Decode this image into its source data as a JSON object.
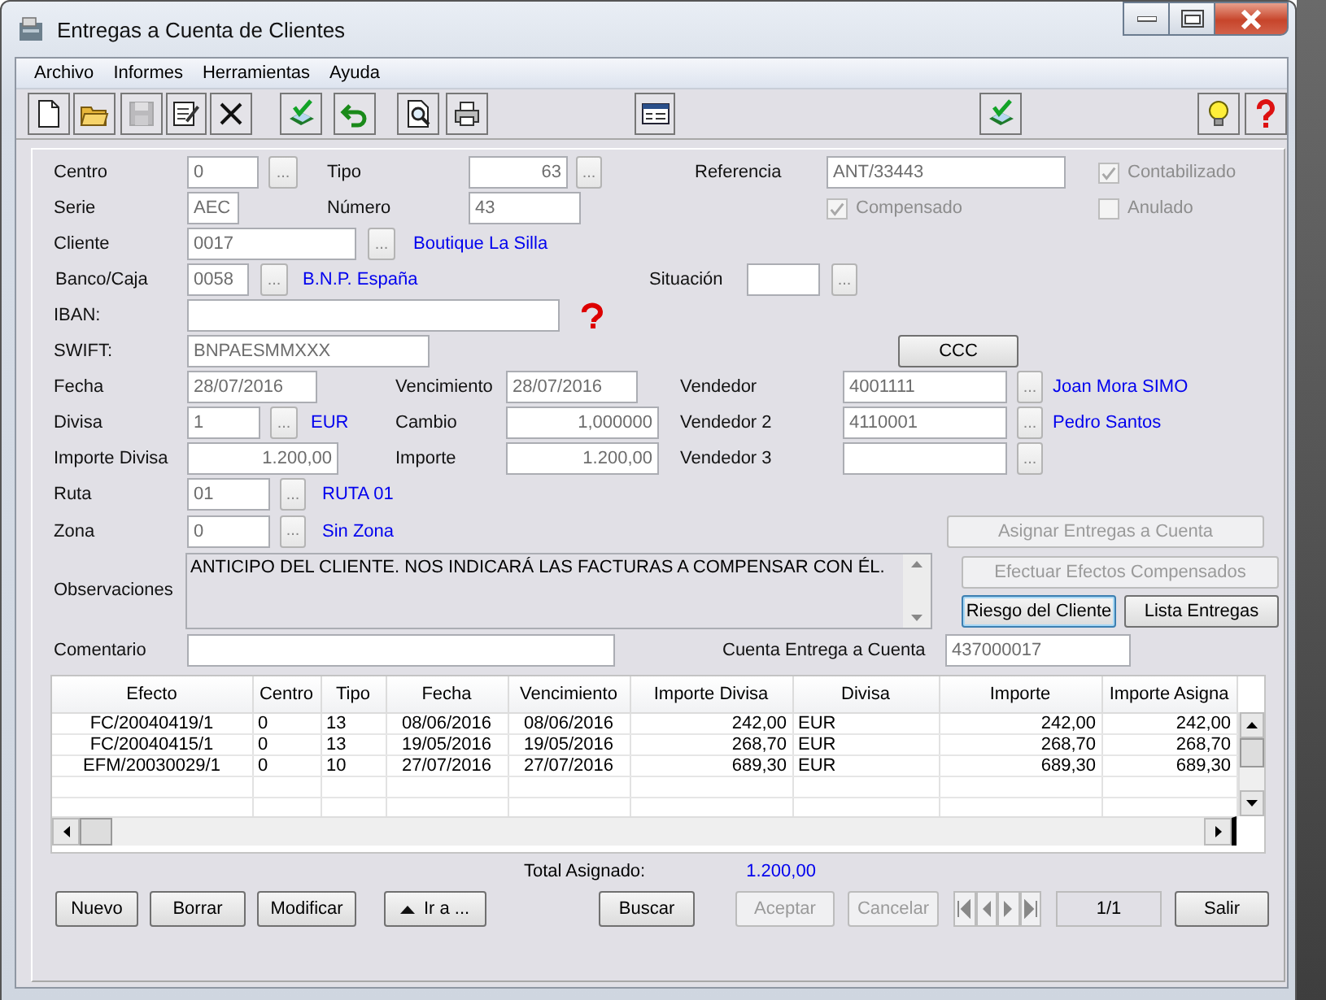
{
  "window": {
    "title": "Entregas a Cuenta de Clientes"
  },
  "menu": [
    "Archivo",
    "Informes",
    "Herramientas",
    "Ayuda"
  ],
  "toolbar": [
    {
      "kind": "new",
      "disabled": false
    },
    {
      "kind": "open",
      "disabled": false
    },
    {
      "kind": "save",
      "disabled": true
    },
    {
      "kind": "edit",
      "disabled": false
    },
    {
      "kind": "delete",
      "disabled": false
    },
    {
      "kind": "stamp",
      "disabled": false
    },
    {
      "kind": "undo",
      "disabled": false
    },
    {
      "kind": "preview",
      "disabled": false
    },
    {
      "kind": "print",
      "disabled": false
    },
    {
      "kind": "form",
      "disabled": false
    },
    {
      "kind": "stamp",
      "disabled": false
    },
    {
      "kind": "tip",
      "disabled": false
    },
    {
      "kind": "help",
      "disabled": false
    }
  ],
  "form": [
    [
      {
        "kind": "label",
        "text": "Centro"
      },
      {
        "kind": "field",
        "value": "0"
      },
      {
        "kind": "lookup",
        "text": "..."
      },
      {
        "kind": "label",
        "text": "Tipo"
      },
      {
        "kind": "field",
        "value": "63"
      },
      {
        "kind": "lookup",
        "text": "..."
      },
      {
        "kind": "label",
        "text": "Referencia"
      },
      {
        "kind": "field",
        "value": "ANT/33443"
      },
      {
        "kind": "checkbox",
        "text": "Contabilizado",
        "checked": true,
        "disabled": true
      }
    ],
    [
      {
        "kind": "label",
        "text": "Serie"
      },
      {
        "kind": "field",
        "value": "AEC"
      },
      {
        "kind": "label",
        "text": "Número"
      },
      {
        "kind": "field",
        "value": "43"
      },
      {
        "kind": "checkbox",
        "text": "Compensado",
        "checked": true,
        "disabled": true
      },
      {
        "kind": "checkbox",
        "text": "Anulado",
        "checked": false,
        "disabled": true
      }
    ],
    [
      {
        "kind": "label",
        "text": "Cliente"
      },
      {
        "kind": "field",
        "value": "0017"
      },
      {
        "kind": "lookup",
        "text": "..."
      },
      {
        "kind": "link",
        "text": "Boutique La Silla"
      }
    ],
    [
      {
        "kind": "label",
        "text": "Banco/Caja"
      },
      {
        "kind": "field",
        "value": "0058"
      },
      {
        "kind": "lookup",
        "text": "..."
      },
      {
        "kind": "link",
        "text": "B.N.P. España"
      },
      {
        "kind": "label",
        "text": "Situación"
      },
      {
        "kind": "field"
      },
      {
        "kind": "lookup",
        "text": "..."
      }
    ],
    [
      {
        "kind": "label",
        "text": "IBAN:"
      },
      {
        "kind": "field"
      },
      {
        "kind": "help"
      }
    ],
    [
      {
        "kind": "label",
        "text": "SWIFT:"
      },
      {
        "kind": "field",
        "value": "BNPAESMMXXX"
      },
      {
        "kind": "button",
        "text": "CCC",
        "disabled": false
      }
    ],
    [
      {
        "kind": "label",
        "text": "Fecha"
      },
      {
        "kind": "field",
        "value": "28/07/2016"
      },
      {
        "kind": "label",
        "text": "Vencimiento"
      },
      {
        "kind": "field",
        "value": "28/07/2016"
      },
      {
        "kind": "label",
        "text": "Vendedor"
      },
      {
        "kind": "field",
        "value": "4001111"
      },
      {
        "kind": "lookup",
        "text": "..."
      },
      {
        "kind": "link",
        "text": "Joan Mora SIMO"
      }
    ],
    [
      {
        "kind": "label",
        "text": "Divisa"
      },
      {
        "kind": "field",
        "value": "1"
      },
      {
        "kind": "lookup",
        "text": "..."
      },
      {
        "kind": "link",
        "text": "EUR"
      },
      {
        "kind": "label",
        "text": "Cambio"
      },
      {
        "kind": "field",
        "value": "1,000000"
      },
      {
        "kind": "label",
        "text": "Vendedor 2"
      },
      {
        "kind": "field",
        "value": "4110001"
      },
      {
        "kind": "lookup",
        "text": "..."
      },
      {
        "kind": "link",
        "text": "Pedro Santos"
      }
    ],
    [
      {
        "kind": "label",
        "text": "Importe Divisa"
      },
      {
        "kind": "field",
        "value": "1.200,00"
      },
      {
        "kind": "label",
        "text": "Importe"
      },
      {
        "kind": "field",
        "value": "1.200,00"
      },
      {
        "kind": "label",
        "text": "Vendedor 3"
      },
      {
        "kind": "field"
      },
      {
        "kind": "lookup",
        "text": "..."
      }
    ],
    [
      {
        "kind": "label",
        "text": "Ruta"
      },
      {
        "kind": "field",
        "value": "01"
      },
      {
        "kind": "lookup",
        "text": "..."
      },
      {
        "kind": "link",
        "text": "RUTA 01"
      }
    ],
    [
      {
        "kind": "label",
        "text": "Zona"
      },
      {
        "kind": "field",
        "value": "0"
      },
      {
        "kind": "lookup",
        "text": "..."
      },
      {
        "kind": "link",
        "text": "Sin Zona"
      },
      {
        "kind": "button",
        "text": "Asignar Entregas a Cuenta",
        "disabled": true
      }
    ],
    [
      {
        "kind": "label",
        "text": "Observaciones"
      },
      {
        "kind": "textarea",
        "value": "ANTICIPO DEL CLIENTE. NOS INDICARÁ LAS FACTURAS A COMPENSAR CON ÉL."
      },
      {
        "kind": "button",
        "text": "Efectuar Efectos Compensados",
        "disabled": true
      },
      {
        "kind": "button",
        "text": "Riesgo del Cliente",
        "disabled": false,
        "focused": true
      },
      {
        "kind": "button",
        "text": "Lista Entregas",
        "disabled": false,
        "focused": false
      }
    ],
    [
      {
        "kind": "label",
        "text": "Comentario"
      },
      {
        "kind": "field"
      },
      {
        "kind": "label",
        "text": "Cuenta Entrega a Cuenta"
      },
      {
        "kind": "field",
        "value": "437000017"
      }
    ]
  ],
  "table": {
    "columns": [
      "Efecto",
      "Centro",
      "Tipo",
      "Fecha",
      "Vencimiento",
      "Importe Divisa",
      "Divisa",
      "Importe",
      "Importe Asigna"
    ],
    "rows": [
      [
        "FC/20040419/1",
        "0",
        "13",
        "08/06/2016",
        "08/06/2016",
        "242,00",
        "EUR",
        "242,00",
        "242,00"
      ],
      [
        "FC/20040415/1",
        "0",
        "13",
        "19/05/2016",
        "19/05/2016",
        "268,70",
        "EUR",
        "268,70",
        "268,70"
      ],
      [
        "EFM/20030029/1",
        "0",
        "10",
        "27/07/2016",
        "27/07/2016",
        "689,30",
        "EUR",
        "689,30",
        "689,30"
      ]
    ]
  },
  "total": {
    "label": "Total Asignado:",
    "value": "1.200,00"
  },
  "buttons": [
    {
      "text": "Nuevo",
      "disabled": false
    },
    {
      "text": "Borrar",
      "disabled": false
    },
    {
      "text": "Modificar",
      "disabled": false
    },
    {
      "text": "Ir a ...",
      "disabled": false,
      "kind": "goto"
    },
    {
      "text": "Buscar",
      "disabled": false
    },
    {
      "text": "Aceptar",
      "disabled": true
    },
    {
      "text": "Cancelar",
      "disabled": true
    },
    {
      "kind": "nav"
    },
    {
      "kind": "record",
      "text": "1/1"
    },
    {
      "text": "Salir",
      "disabled": false
    }
  ]
}
